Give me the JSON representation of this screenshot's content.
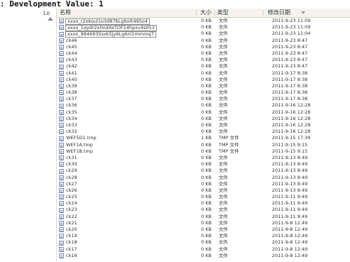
{
  "console": {
    "text": ": Development Value: 1"
  },
  "sidebar": {
    "fragment": "Lo"
  },
  "columns": {
    "name": "名称",
    "size": "大小",
    "type": "类型",
    "date": "修改日期"
  },
  "files": [
    {
      "name": "xxxx_r2okoul1o3d87bLg6xtt495o4",
      "size": "0 KB",
      "type": "文件",
      "date": "2011-9-23 11:09",
      "boxed": true
    },
    {
      "name": "xxxx_1qydr2xlmdXeTOF14hpxv4s053",
      "size": "0 KB",
      "type": "文件",
      "date": "2011-9-23 11:09",
      "boxed": true
    },
    {
      "name": "xxxx_9846935sxk5jy6Lg6nl1mmmq7",
      "size": "0 KB",
      "type": "文件",
      "date": "2011-9-23 11:04",
      "boxed": true
    },
    {
      "name": "ck46",
      "size": "0 KB",
      "type": "文件",
      "date": "2011-9-23 8:47"
    },
    {
      "name": "ck45",
      "size": "0 KB",
      "type": "文件",
      "date": "2011-9-23 8:47"
    },
    {
      "name": "ck44",
      "size": "0 KB",
      "type": "文件",
      "date": "2011-9-23 8:47"
    },
    {
      "name": "ck43",
      "size": "0 KB",
      "type": "文件",
      "date": "2011-9-23 8:47"
    },
    {
      "name": "ck42",
      "size": "0 KB",
      "type": "文件",
      "date": "2011-9-23 8:47"
    },
    {
      "name": "ck41",
      "size": "0 KB",
      "type": "文件",
      "date": "2011-9-17 8:38"
    },
    {
      "name": "ck40",
      "size": "0 KB",
      "type": "文件",
      "date": "2011-9-17 8:38"
    },
    {
      "name": "ck39",
      "size": "0 KB",
      "type": "文件",
      "date": "2011-9-17 8:38"
    },
    {
      "name": "ck38",
      "size": "0 KB",
      "type": "文件",
      "date": "2011-9-17 8:38"
    },
    {
      "name": "ck37",
      "size": "0 KB",
      "type": "文件",
      "date": "2011-9-17 8:38"
    },
    {
      "name": "ck36",
      "size": "0 KB",
      "type": "文件",
      "date": "2011-9-16 12:28"
    },
    {
      "name": "ck35",
      "size": "0 KB",
      "type": "文件",
      "date": "2011-9-16 12:28"
    },
    {
      "name": "ck34",
      "size": "0 KB",
      "type": "文件",
      "date": "2011-9-16 12:28"
    },
    {
      "name": "ck33",
      "size": "0 KB",
      "type": "文件",
      "date": "2011-9-16 12:28"
    },
    {
      "name": "ck32",
      "size": "0 KB",
      "type": "文件",
      "date": "2011-9-16 12:28"
    },
    {
      "name": "WEF5D1.tmp",
      "size": "1 KB",
      "type": "TMP 文件",
      "date": "2011-9-15 17:39"
    },
    {
      "name": "WEF1A.tmp",
      "size": "0 KB",
      "type": "TMP 文件",
      "date": "2011-9-15 9:15"
    },
    {
      "name": "WEF1B.tmp",
      "size": "0 KB",
      "type": "TMP 文件",
      "date": "2011-9-15 9:15"
    },
    {
      "name": "ck31",
      "size": "0 KB",
      "type": "文件",
      "date": "2011-9-13 8:49"
    },
    {
      "name": "ck30",
      "size": "0 KB",
      "type": "文件",
      "date": "2011-9-13 8:49"
    },
    {
      "name": "ck29",
      "size": "0 KB",
      "type": "文件",
      "date": "2011-9-13 8:49"
    },
    {
      "name": "ck28",
      "size": "0 KB",
      "type": "文件",
      "date": "2011-9-13 8:49"
    },
    {
      "name": "ck27",
      "size": "0 KB",
      "type": "文件",
      "date": "2011-9-13 8:49"
    },
    {
      "name": "ck26",
      "size": "0 KB",
      "type": "文件",
      "date": "2011-9-13 8:49"
    },
    {
      "name": "ck25",
      "size": "0 KB",
      "type": "文件",
      "date": "2011-9-11 9:49"
    },
    {
      "name": "ck24",
      "size": "0 KB",
      "type": "文件",
      "date": "2011-9-11 9:49"
    },
    {
      "name": "ck23",
      "size": "0 KB",
      "type": "文件",
      "date": "2011-9-11 9:49"
    },
    {
      "name": "ck22",
      "size": "0 KB",
      "type": "文件",
      "date": "2011-9-11 9:49"
    },
    {
      "name": "ck21",
      "size": "0 KB",
      "type": "文件",
      "date": "2011-9-8 12:49"
    },
    {
      "name": "ck20",
      "size": "0 KB",
      "type": "文件",
      "date": "2011-9-8 12:49"
    },
    {
      "name": "ck19",
      "size": "0 KB",
      "type": "文件",
      "date": "2011-9-8 12:49"
    },
    {
      "name": "ck18",
      "size": "0 KB",
      "type": "文件",
      "date": "2011-9-8 12:49"
    },
    {
      "name": "ck17",
      "size": "0 KB",
      "type": "文件",
      "date": "2011-9-8 12:49"
    },
    {
      "name": "ck16",
      "size": "0 KB",
      "type": "文件",
      "date": "2011-9-8 12:49"
    }
  ]
}
